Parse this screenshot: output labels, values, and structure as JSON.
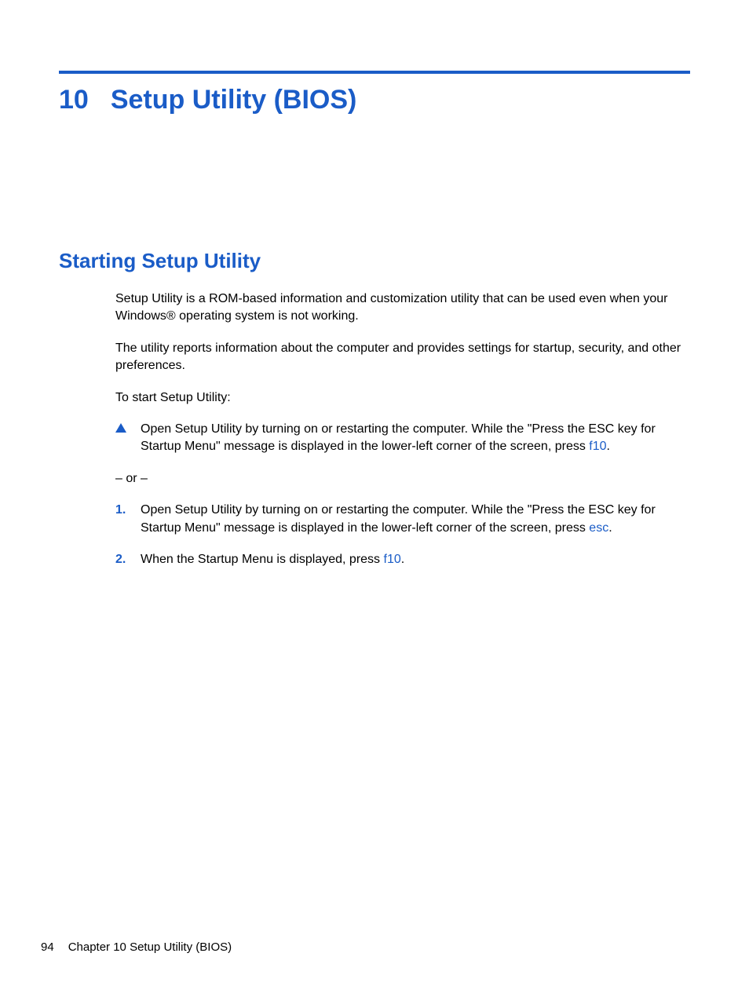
{
  "chapter": {
    "number": "10",
    "title": "Setup Utility (BIOS)"
  },
  "section": {
    "title": "Starting Setup Utility"
  },
  "paragraphs": {
    "p1": "Setup Utility is a ROM-based information and customization utility that can be used even when your Windows® operating system is not working.",
    "p2": "The utility reports information about the computer and provides settings for startup, security, and other preferences.",
    "p3": "To start Setup Utility:",
    "or": "– or –"
  },
  "bullets": {
    "triangle": {
      "text_before": "Open Setup Utility by turning on or restarting the computer. While the \"Press the ESC key for Startup Menu\" message is displayed in the lower-left corner of the screen, press ",
      "key": "f10",
      "text_after": "."
    },
    "step1": {
      "num": "1.",
      "text_before": "Open Setup Utility by turning on or restarting the computer. While the \"Press the ESC key for Startup Menu\" message is displayed in the lower-left corner of the screen, press ",
      "key": "esc",
      "text_after": "."
    },
    "step2": {
      "num": "2.",
      "text_before": "When the Startup Menu is displayed, press ",
      "key": "f10",
      "text_after": "."
    }
  },
  "footer": {
    "page_number": "94",
    "chapter_label": "Chapter 10   Setup Utility (BIOS)"
  }
}
